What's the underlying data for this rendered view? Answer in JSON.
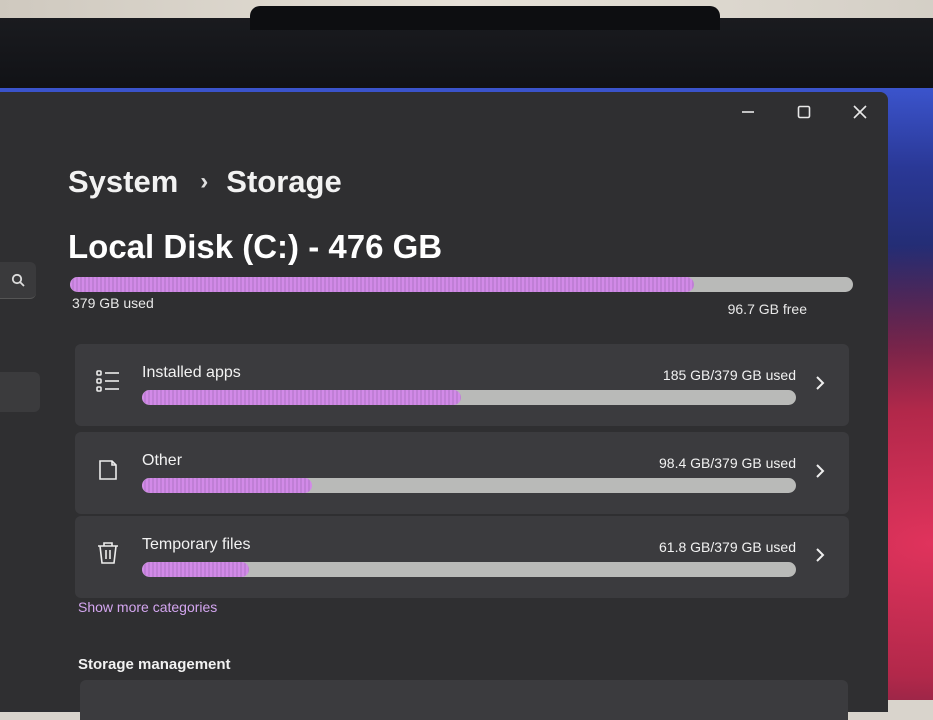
{
  "breadcrumb": {
    "parent": "System",
    "separator": "›",
    "current": "Storage"
  },
  "disk": {
    "title": "Local Disk (C:) - 476 GB",
    "used_label": "379 GB used",
    "free_label": "96.7 GB free",
    "used_fraction": 0.797
  },
  "categories": [
    {
      "name": "Installed apps",
      "size": "185 GB/379 GB used",
      "fraction": 0.488,
      "icon": "apps-list-icon"
    },
    {
      "name": "Other",
      "size": "98.4 GB/379 GB used",
      "fraction": 0.26,
      "icon": "document-icon"
    },
    {
      "name": "Temporary files",
      "size": "61.8 GB/379 GB used",
      "fraction": 0.163,
      "icon": "trash-icon"
    }
  ],
  "show_more_label": "Show more categories",
  "storage_management_label": "Storage management",
  "colors": {
    "accent": "#d28ae8",
    "track": "#b9bab8",
    "window_bg": "#2f2f31",
    "card_bg": "#3b3b3e"
  }
}
